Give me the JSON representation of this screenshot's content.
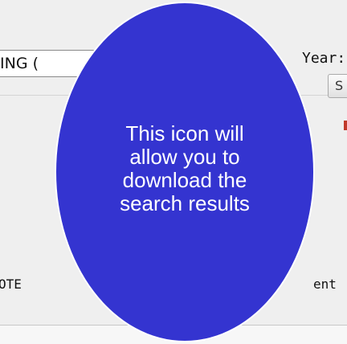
{
  "background_fields": {
    "top_field_value": "ING (",
    "year_label": "Year:",
    "year_select_value": "S",
    "left_label": "OTE",
    "right_label": "ent"
  },
  "tooltip": {
    "text": "This icon will allow you to download the search results",
    "background_color": "#3434d0",
    "text_color": "#ffffff"
  }
}
